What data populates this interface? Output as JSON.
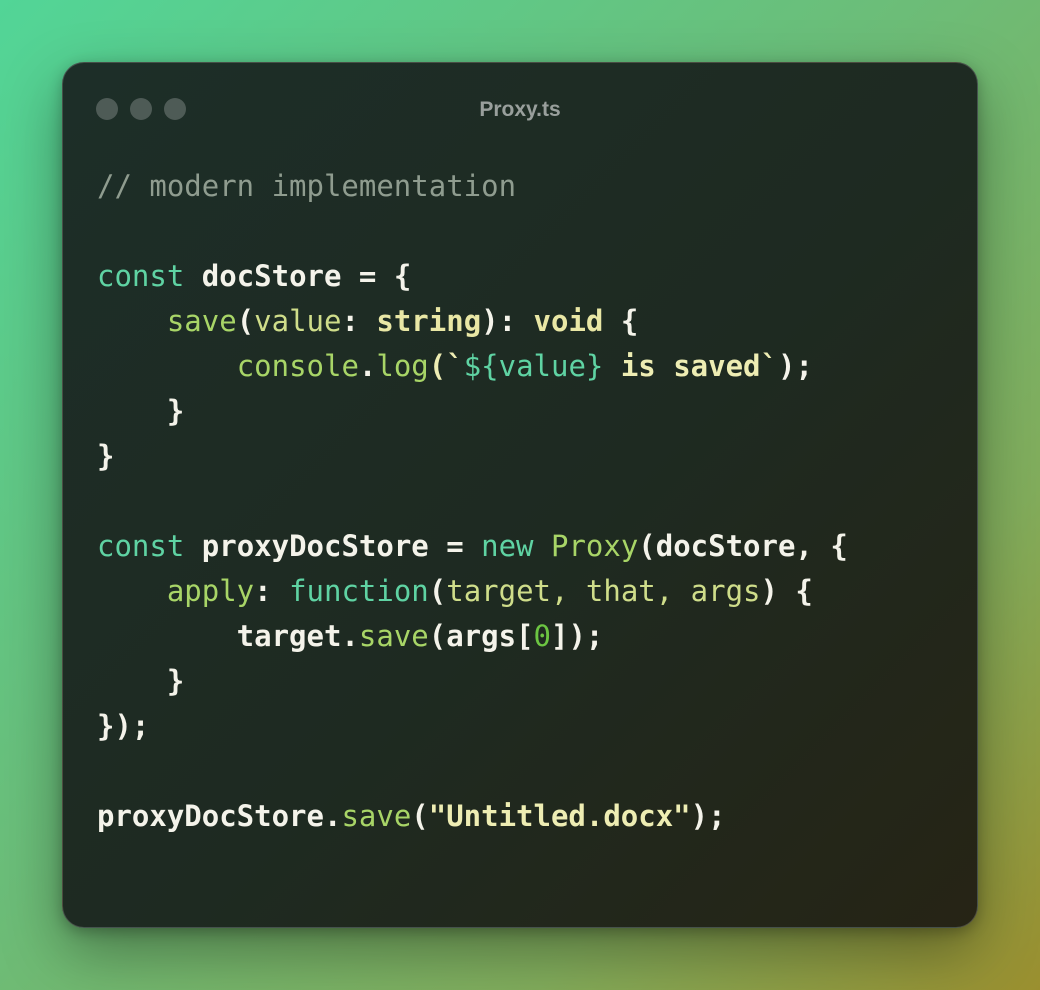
{
  "window": {
    "title": "Proxy.ts"
  },
  "editor": {
    "lines": [
      [
        {
          "t": "// modern implementation",
          "c": "cm"
        }
      ],
      [],
      [
        {
          "t": "const",
          "c": "kw"
        },
        {
          "t": " docStore = {",
          "c": "id"
        }
      ],
      [
        {
          "t": "    ",
          "c": "id"
        },
        {
          "t": "save",
          "c": "fn"
        },
        {
          "t": "(",
          "c": "punc"
        },
        {
          "t": "value",
          "c": "param"
        },
        {
          "t": ": ",
          "c": "punc"
        },
        {
          "t": "string",
          "c": "type"
        },
        {
          "t": "): ",
          "c": "punc"
        },
        {
          "t": "void",
          "c": "type"
        },
        {
          "t": " {",
          "c": "punc"
        }
      ],
      [
        {
          "t": "        ",
          "c": "id"
        },
        {
          "t": "console",
          "c": "fn"
        },
        {
          "t": ".",
          "c": "punc"
        },
        {
          "t": "log",
          "c": "fn"
        },
        {
          "t": "(`",
          "c": "str"
        },
        {
          "t": "${value}",
          "c": "interp"
        },
        {
          "t": " is saved`",
          "c": "str"
        },
        {
          "t": ");",
          "c": "punc"
        }
      ],
      [
        {
          "t": "    }",
          "c": "punc"
        }
      ],
      [
        {
          "t": "}",
          "c": "punc"
        }
      ],
      [],
      [
        {
          "t": "const",
          "c": "kw"
        },
        {
          "t": " proxyDocStore = ",
          "c": "id"
        },
        {
          "t": "new",
          "c": "kw"
        },
        {
          "t": " ",
          "c": "id"
        },
        {
          "t": "Proxy",
          "c": "fn"
        },
        {
          "t": "(docStore, {",
          "c": "punc"
        }
      ],
      [
        {
          "t": "    ",
          "c": "id"
        },
        {
          "t": "apply",
          "c": "fn"
        },
        {
          "t": ": ",
          "c": "punc"
        },
        {
          "t": "function",
          "c": "kw"
        },
        {
          "t": "(",
          "c": "punc"
        },
        {
          "t": "target, that, args",
          "c": "param"
        },
        {
          "t": ") {",
          "c": "punc"
        }
      ],
      [
        {
          "t": "        target.",
          "c": "id"
        },
        {
          "t": "save",
          "c": "fn"
        },
        {
          "t": "(args[",
          "c": "punc"
        },
        {
          "t": "0",
          "c": "num"
        },
        {
          "t": "]);",
          "c": "punc"
        }
      ],
      [
        {
          "t": "    }",
          "c": "punc"
        }
      ],
      [
        {
          "t": "});",
          "c": "punc"
        }
      ],
      [],
      [
        {
          "t": "proxyDocStore.",
          "c": "id"
        },
        {
          "t": "save",
          "c": "fn"
        },
        {
          "t": "(",
          "c": "punc"
        },
        {
          "t": "\"Untitled.docx\"",
          "c": "str"
        },
        {
          "t": ");",
          "c": "punc"
        }
      ]
    ]
  }
}
